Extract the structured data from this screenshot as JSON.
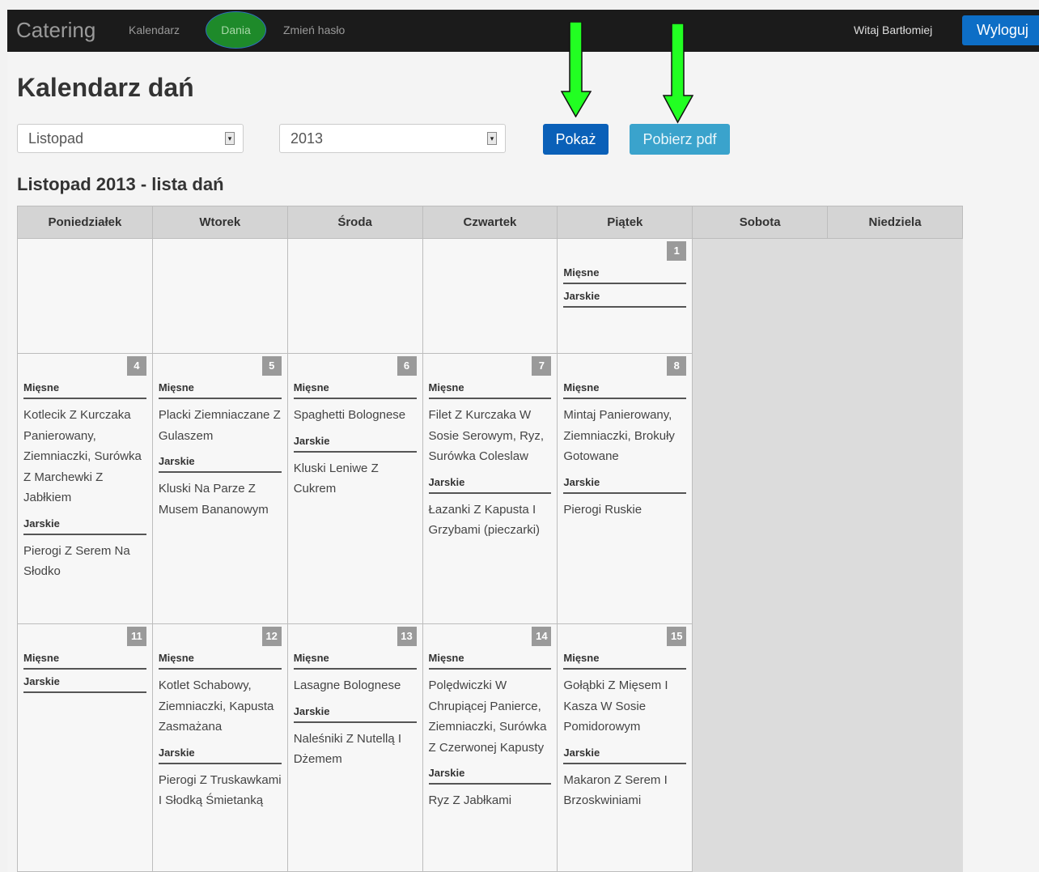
{
  "navbar": {
    "brand": "Catering",
    "links": [
      "Kalendarz",
      "Dania",
      "Zmień hasło"
    ],
    "greeting": "Witaj Bartłomiej",
    "logout_label": "Wyloguj"
  },
  "title": "Kalendarz dań",
  "filters": {
    "month_value": "Listopad",
    "year_value": "2013",
    "show_label": "Pokaż",
    "pdf_label": "Pobierz pdf"
  },
  "list_title": "Listopad 2013 - lista dań",
  "weekdays": [
    "Poniedziałek",
    "Wtorek",
    "Środa",
    "Czwartek",
    "Piątek",
    "Sobota",
    "Niedziela"
  ],
  "categories": {
    "meat": "Mięsne",
    "veg": "Jarskie"
  },
  "days": {
    "d1": {
      "num": "1",
      "meat": "",
      "veg": ""
    },
    "d4": {
      "num": "4",
      "meat": "Kotlecik Z Kurczaka Panierowany, Ziemniaczki, Surówka Z Marchewki Z Jabłkiem",
      "veg": "Pierogi Z Serem Na Słodko"
    },
    "d5": {
      "num": "5",
      "meat": "Placki Ziemniaczane Z Gulaszem",
      "veg": "Kluski Na Parze Z Musem Bananowym"
    },
    "d6": {
      "num": "6",
      "meat": "Spaghetti Bolognese",
      "veg": "Kluski Leniwe Z Cukrem"
    },
    "d7": {
      "num": "7",
      "meat": "Filet Z Kurczaka W Sosie Serowym, Ryz, Surówka Coleslaw",
      "veg": "Łazanki Z Kapusta I Grzybami (pieczarki)"
    },
    "d8": {
      "num": "8",
      "meat": "Mintaj Panierowany, Ziemniaczki, Brokuły Gotowane",
      "veg": "Pierogi Ruskie"
    },
    "d11": {
      "num": "11",
      "meat": "",
      "veg": ""
    },
    "d12": {
      "num": "12",
      "meat": "Kotlet Schabowy, Ziemniaczki, Kapusta Zasmażana",
      "veg": "Pierogi Z Truskawkami I Słodką Śmietanką"
    },
    "d13": {
      "num": "13",
      "meat": "Lasagne Bolognese",
      "veg": "Naleśniki Z Nutellą I Dżemem"
    },
    "d14": {
      "num": "14",
      "meat": "Polędwiczki W Chrupiącej Panierce, Ziemniaczki, Surówka Z Czerwonej Kapusty",
      "veg": "Ryz Z Jabłkami"
    },
    "d15": {
      "num": "15",
      "meat": "Gołąbki Z Mięsem I Kasza W Sosie Pomidorowym",
      "veg": "Makaron Z Serem I Brzoskwiniami"
    }
  },
  "colors": {
    "navbar": "#1b1b1b",
    "active_nav": "#1e8a2a",
    "primary": "#0a60b8",
    "info": "#3aa3cc",
    "annotation_arrow": "#22ff22"
  }
}
